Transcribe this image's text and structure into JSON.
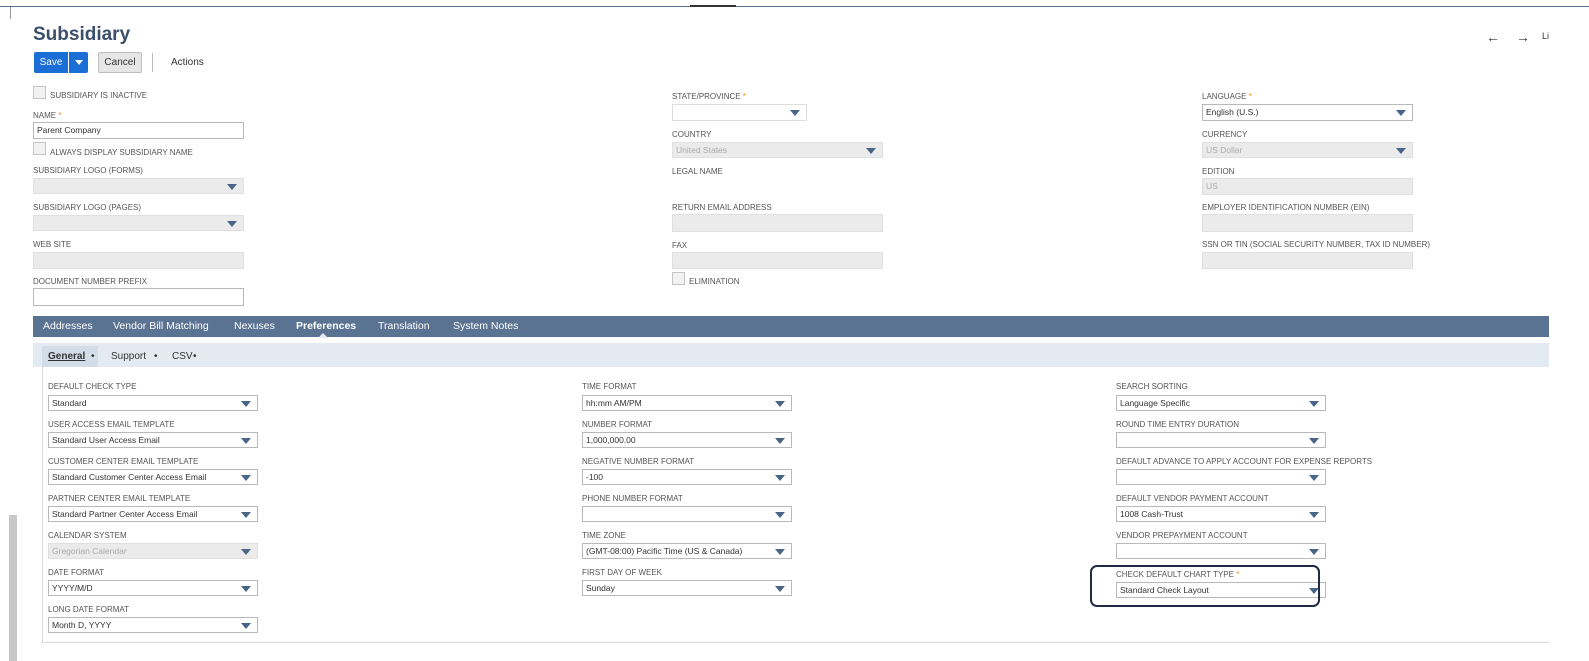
{
  "page": {
    "title": "Subsidiary",
    "buttons": {
      "save": "Save",
      "cancel": "Cancel",
      "actions": "Actions"
    },
    "nav": {
      "back": "←",
      "forward": "→",
      "list": "Li"
    }
  },
  "main_fields": {
    "inactive_label": "SUBSIDIARY IS INACTIVE",
    "name_label": "NAME",
    "name_value": "Parent Company",
    "always_display_label": "ALWAYS DISPLAY SUBSIDIARY NAME",
    "logo_forms_label": "SUBSIDIARY LOGO (FORMS)",
    "logo_pages_label": "SUBSIDIARY LOGO (PAGES)",
    "web_site_label": "WEB SITE",
    "doc_prefix_label": "DOCUMENT NUMBER PREFIX",
    "state_label": "STATE/PROVINCE",
    "country_label": "COUNTRY",
    "country_value": "United States",
    "legal_name_label": "LEGAL NAME",
    "return_email_label": "RETURN EMAIL ADDRESS",
    "fax_label": "FAX",
    "elimination_label": "ELIMINATION",
    "language_label": "LANGUAGE",
    "language_value": "English (U.S.)",
    "currency_label": "CURRENCY",
    "currency_value": "US Dollar",
    "edition_label": "EDITION",
    "edition_value": "US",
    "ein_label": "EMPLOYER IDENTIFICATION NUMBER (EIN)",
    "ssn_label": "SSN OR TIN (SOCIAL SECURITY NUMBER, TAX ID NUMBER)",
    "required_mark": "*"
  },
  "tabs": [
    "Addresses",
    "Vendor Bill Matching",
    "Nexuses",
    "Preferences",
    "Translation",
    "System Notes"
  ],
  "subtabs": [
    "General",
    "Support",
    "CSV"
  ],
  "subtab_dot": "•",
  "preferences": {
    "col1": [
      {
        "label": "DEFAULT CHECK TYPE",
        "value": "Standard"
      },
      {
        "label": "USER ACCESS EMAIL TEMPLATE",
        "value": "Standard User Access Email"
      },
      {
        "label": "CUSTOMER CENTER EMAIL TEMPLATE",
        "value": "Standard Customer Center Access Email"
      },
      {
        "label": "PARTNER CENTER EMAIL TEMPLATE",
        "value": "Standard Partner Center Access Email"
      },
      {
        "label": "CALENDAR SYSTEM",
        "value": "Gregorian Calendar"
      },
      {
        "label": "DATE FORMAT",
        "value": "YYYY/M/D"
      },
      {
        "label": "LONG DATE FORMAT",
        "value": "Month D, YYYY"
      }
    ],
    "col2": [
      {
        "label": "TIME FORMAT",
        "value": "hh:mm AM/PM"
      },
      {
        "label": "NUMBER FORMAT",
        "value": "1,000,000.00"
      },
      {
        "label": "NEGATIVE NUMBER FORMAT",
        "value": "-100"
      },
      {
        "label": "PHONE NUMBER FORMAT",
        "value": ""
      },
      {
        "label": "TIME ZONE",
        "value": "(GMT-08:00) Pacific Time (US & Canada)"
      },
      {
        "label": "FIRST DAY OF WEEK",
        "value": "Sunday"
      }
    ],
    "col3": [
      {
        "label": "SEARCH SORTING",
        "value": "Language Specific"
      },
      {
        "label": "ROUND TIME ENTRY DURATION",
        "value": ""
      },
      {
        "label": "DEFAULT ADVANCE TO APPLY ACCOUNT FOR EXPENSE REPORTS",
        "value": ""
      },
      {
        "label": "DEFAULT VENDOR PAYMENT ACCOUNT",
        "value": "1008 Cash-Trust"
      },
      {
        "label": "VENDOR PREPAYMENT ACCOUNT",
        "value": ""
      },
      {
        "label": "CHECK DEFAULT CHART TYPE",
        "value": "Standard Check Layout"
      }
    ]
  }
}
